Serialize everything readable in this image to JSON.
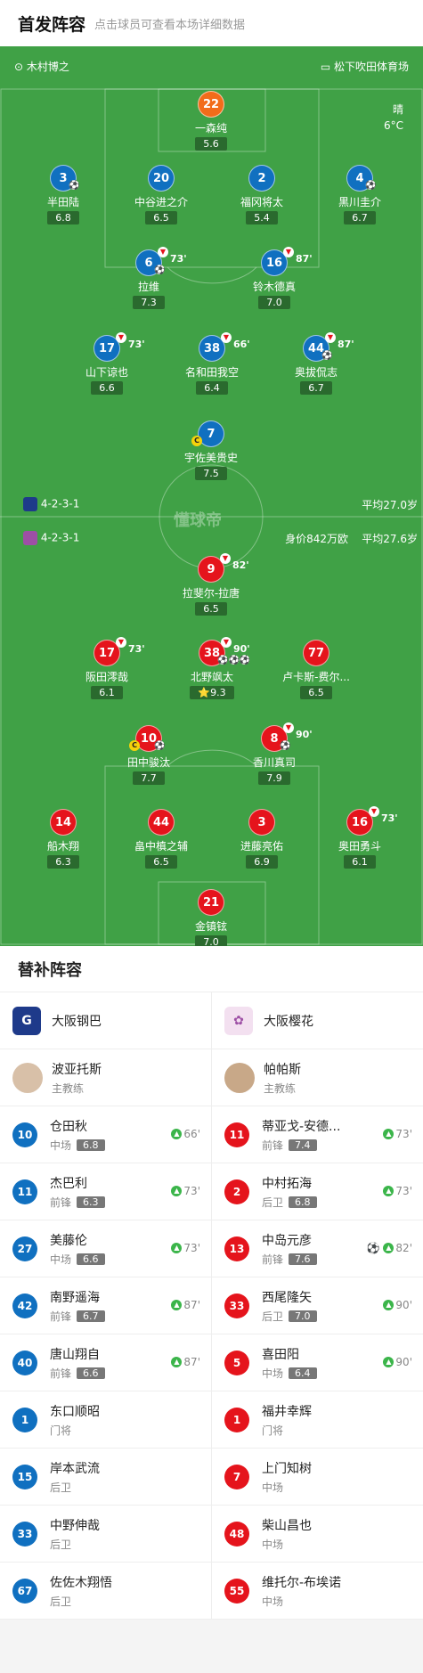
{
  "header": {
    "title": "首发阵容",
    "subtitle": "点击球员可查看本场详细数据"
  },
  "match": {
    "referee": "木村博之",
    "stadium": "松下吹田体育场",
    "weather": "晴",
    "temp": "6°C",
    "watermark": "懂球帝"
  },
  "home": {
    "formation": "4-2-3-1",
    "avg_age": "平均27.0岁"
  },
  "away": {
    "formation": "4-2-3-1",
    "value": "身价842万欧",
    "avg_age": "平均27.6岁"
  },
  "home_players": [
    {
      "num": "22",
      "name": "一森纯",
      "rating": "5.6"
    },
    {
      "num": "3",
      "name": "半田陆",
      "rating": "6.8"
    },
    {
      "num": "20",
      "name": "中谷进之介",
      "rating": "6.5"
    },
    {
      "num": "2",
      "name": "福冈将太",
      "rating": "5.4"
    },
    {
      "num": "4",
      "name": "黒川圭介",
      "rating": "6.7"
    },
    {
      "num": "6",
      "name": "拉维",
      "rating": "7.3",
      "sub": "73'"
    },
    {
      "num": "16",
      "name": "铃木德真",
      "rating": "7.0",
      "sub": "87'"
    },
    {
      "num": "17",
      "name": "山下谅也",
      "rating": "6.6",
      "sub": "73'"
    },
    {
      "num": "38",
      "name": "名和田我空",
      "rating": "6.4",
      "sub": "66'"
    },
    {
      "num": "44",
      "name": "奥拔侃志",
      "rating": "6.7",
      "sub": "87'"
    },
    {
      "num": "7",
      "name": "宇佐美贵史",
      "rating": "7.5"
    }
  ],
  "away_players": [
    {
      "num": "9",
      "name": "拉斐尔-拉唐",
      "rating": "6.5",
      "sub": "82'"
    },
    {
      "num": "17",
      "name": "阪田澪哉",
      "rating": "6.1",
      "sub": "73'"
    },
    {
      "num": "38",
      "name": "北野飒太",
      "rating": "9.3",
      "sub": "90'"
    },
    {
      "num": "77",
      "name": "卢卡斯-费尔...",
      "rating": "6.5"
    },
    {
      "num": "10",
      "name": "田中骏汰",
      "rating": "7.7"
    },
    {
      "num": "8",
      "name": "香川真司",
      "rating": "7.9",
      "sub": "90'"
    },
    {
      "num": "14",
      "name": "船木翔",
      "rating": "6.3"
    },
    {
      "num": "44",
      "name": "畠中槙之辅",
      "rating": "6.5"
    },
    {
      "num": "3",
      "name": "进藤亮佑",
      "rating": "6.9"
    },
    {
      "num": "16",
      "name": "奥田勇斗",
      "rating": "6.1",
      "sub": "73'"
    },
    {
      "num": "21",
      "name": "金镇铉",
      "rating": "7.0"
    }
  ],
  "subs": {
    "title": "替补阵容",
    "home": {
      "team": "大阪钢巴",
      "coach": "波亚托斯",
      "coach_role": "主教练",
      "players": [
        {
          "num": "10",
          "name": "仓田秋",
          "pos": "中场",
          "rating": "6.8",
          "time": "66'"
        },
        {
          "num": "11",
          "name": "杰巴利",
          "pos": "前锋",
          "rating": "6.3",
          "time": "73'"
        },
        {
          "num": "27",
          "name": "美藤伦",
          "pos": "中场",
          "rating": "6.6",
          "time": "73'"
        },
        {
          "num": "42",
          "name": "南野遥海",
          "pos": "前锋",
          "rating": "6.7",
          "time": "87'"
        },
        {
          "num": "40",
          "name": "唐山翔自",
          "pos": "前锋",
          "rating": "6.6",
          "time": "87'"
        },
        {
          "num": "1",
          "name": "东口顺昭",
          "pos": "门将"
        },
        {
          "num": "15",
          "name": "岸本武流",
          "pos": "后卫"
        },
        {
          "num": "33",
          "name": "中野伸哉",
          "pos": "后卫"
        },
        {
          "num": "67",
          "name": "佐佐木翔悟",
          "pos": "后卫"
        }
      ]
    },
    "away": {
      "team": "大阪樱花",
      "coach": "帕帕斯",
      "coach_role": "主教练",
      "players": [
        {
          "num": "11",
          "name": "蒂亚戈-安德...",
          "pos": "前锋",
          "rating": "7.4",
          "time": "73'"
        },
        {
          "num": "2",
          "name": "中村拓海",
          "pos": "后卫",
          "rating": "6.8",
          "time": "73'"
        },
        {
          "num": "13",
          "name": "中岛元彦",
          "pos": "前锋",
          "rating": "7.6",
          "time": "82'"
        },
        {
          "num": "33",
          "name": "西尾隆矢",
          "pos": "后卫",
          "rating": "7.0",
          "time": "90'"
        },
        {
          "num": "5",
          "name": "喜田阳",
          "pos": "中场",
          "rating": "6.4",
          "time": "90'"
        },
        {
          "num": "1",
          "name": "福井幸辉",
          "pos": "门将"
        },
        {
          "num": "7",
          "name": "上门知树",
          "pos": "中场"
        },
        {
          "num": "48",
          "name": "柴山昌也",
          "pos": "中场"
        },
        {
          "num": "55",
          "name": "维托尔-布埃诺",
          "pos": "中场"
        }
      ]
    }
  }
}
